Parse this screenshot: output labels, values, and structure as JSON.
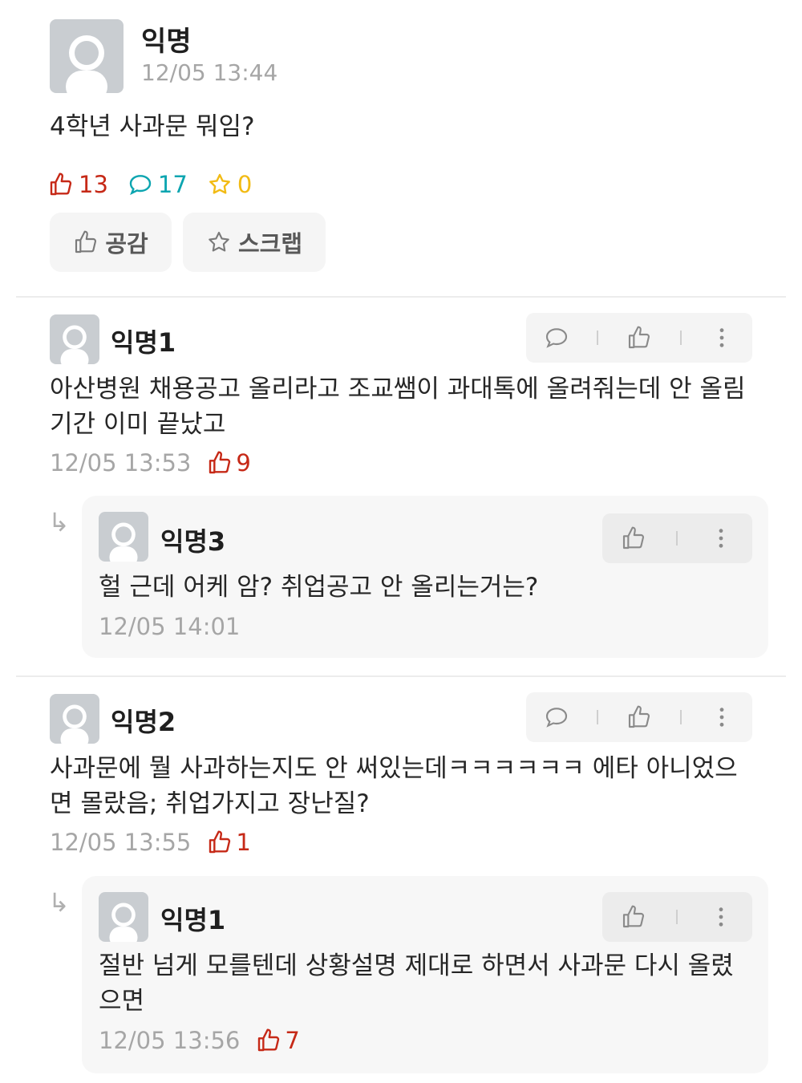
{
  "post": {
    "author": "익명",
    "time": "12/05 13:44",
    "body": "4학년 사과문 뭐임?",
    "likes": "13",
    "comments": "17",
    "scraps": "0",
    "like_button": "공감",
    "scrap_button": "스크랩"
  },
  "comments": [
    {
      "author": "익명1",
      "body": "아산병원 채용공고 올리라고 조교쌤이 과대톡에 올려줘는데 안 올림 기간 이미 끝났고",
      "time": "12/05 13:53",
      "likes": "9",
      "reply": {
        "author": "익명3",
        "body": "헐 근데 어케 암? 취업공고 안 올리는거는?",
        "time": "12/05 14:01"
      }
    },
    {
      "author": "익명2",
      "body": "사과문에 뭘 사과하는지도 안 써있는데ㅋㅋㅋㅋㅋㅋ 에타 아니었으면 몰랐음; 취업가지고 장난질?",
      "time": "12/05 13:55",
      "likes": "1",
      "reply": {
        "author": "익명1",
        "body": "절반 넘게 모를텐데 상황설명 제대로 하면서 사과문 다시 올렸으면",
        "time": "12/05 13:56",
        "likes": "7"
      }
    }
  ],
  "reply_arrow": "↳",
  "colors": {
    "like": "#c62917",
    "comment": "#0ca5b0",
    "scrap": "#f2bb14",
    "muted": "#a6a6a6"
  }
}
